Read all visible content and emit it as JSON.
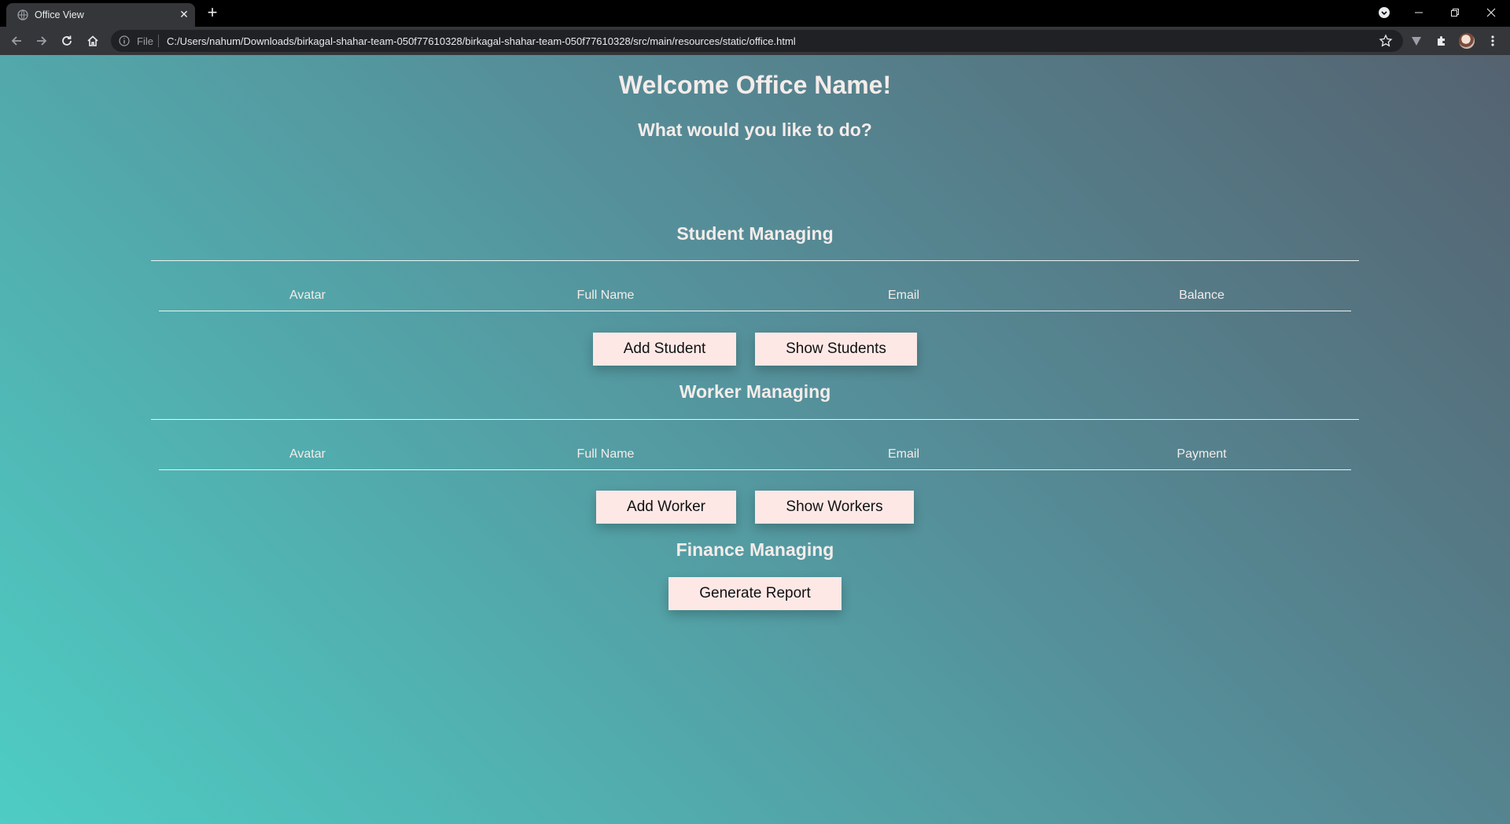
{
  "browser": {
    "tab_title": "Office View",
    "omnibox": {
      "scheme_label": "File",
      "url": "C:/Users/nahum/Downloads/birkagal-shahar-team-050f77610328/birkagal-shahar-team-050f77610328/src/main/resources/static/office.html"
    }
  },
  "page": {
    "title": "Welcome Office Name!",
    "subtitle": "What would you like to do?",
    "student_section": {
      "title": "Student Managing",
      "columns": [
        "Avatar",
        "Full Name",
        "Email",
        "Balance"
      ],
      "add_button": "Add Student",
      "show_button": "Show Students"
    },
    "worker_section": {
      "title": "Worker Managing",
      "columns": [
        "Avatar",
        "Full Name",
        "Email",
        "Payment"
      ],
      "add_button": "Add Worker",
      "show_button": "Show Workers"
    },
    "finance_section": {
      "title": "Finance Managing",
      "report_button": "Generate Report"
    }
  },
  "colors": {
    "gradient_start": "#4ecdc4",
    "gradient_end": "#556270",
    "button_bg": "#fde8e6",
    "text": "#f4ecea"
  }
}
